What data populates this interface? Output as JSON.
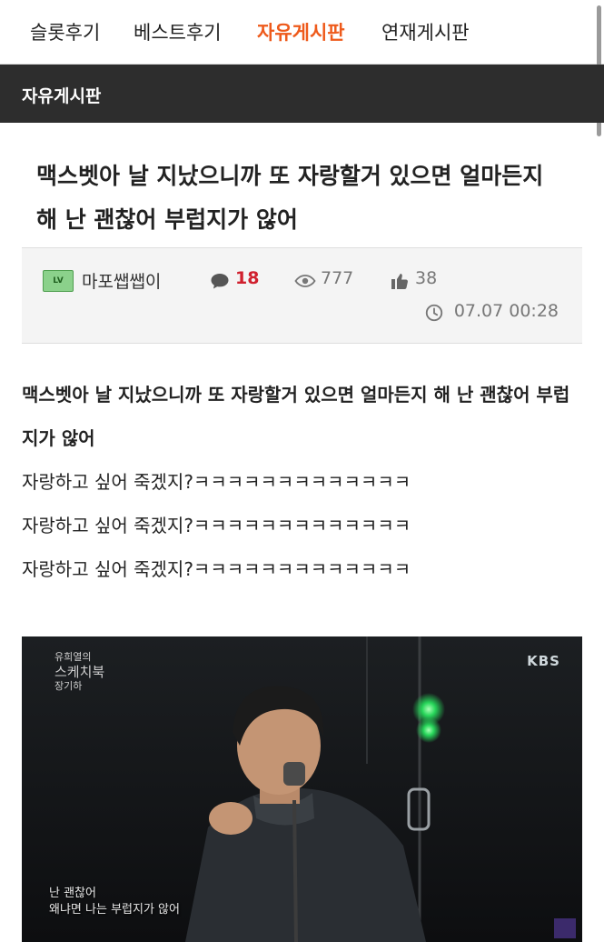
{
  "nav": {
    "tabs": [
      {
        "label": "슬롯후기"
      },
      {
        "label": "베스트후기"
      },
      {
        "label": "자유게시판"
      },
      {
        "label": "연재게시판"
      }
    ],
    "active_color": "#ee5a1b"
  },
  "board": {
    "title": "자유게시판"
  },
  "post": {
    "title": "맥스벳아 날 지났으니까 또 자랑할거 있으면 얼마든지 해 난 괜찮어 부럽지가 않어",
    "author": "마포쌥쌥이",
    "level_icon": "level-badge-icon",
    "comments": "18",
    "views": "777",
    "likes": "38",
    "datetime": "07.07 00:28",
    "body": {
      "headline": "맥스벳아 날 지났으니까 또 자랑할거 있으면 얼마든지 해 난 괜찮어 부럽지가 않어",
      "lines": [
        "자랑하고 싶어 죽겠지?ㅋㅋㅋㅋㅋㅋㅋㅋㅋㅋㅋㅋㅋ",
        "자랑하고 싶어 죽겠지?ㅋㅋㅋㅋㅋㅋㅋㅋㅋㅋㅋㅋㅋ",
        "자랑하고 싶어 죽겠지?ㅋㅋㅋㅋㅋㅋㅋㅋㅋㅋㅋㅋㅋ"
      ]
    },
    "video": {
      "broadcaster": "KBS",
      "show_title_1": "유희열의",
      "show_title_2": "스케치북",
      "show_sub": "장기하",
      "caption_1": "난 괜찮어",
      "caption_2": "왜냐면 나는 부럽지가 않어"
    }
  }
}
